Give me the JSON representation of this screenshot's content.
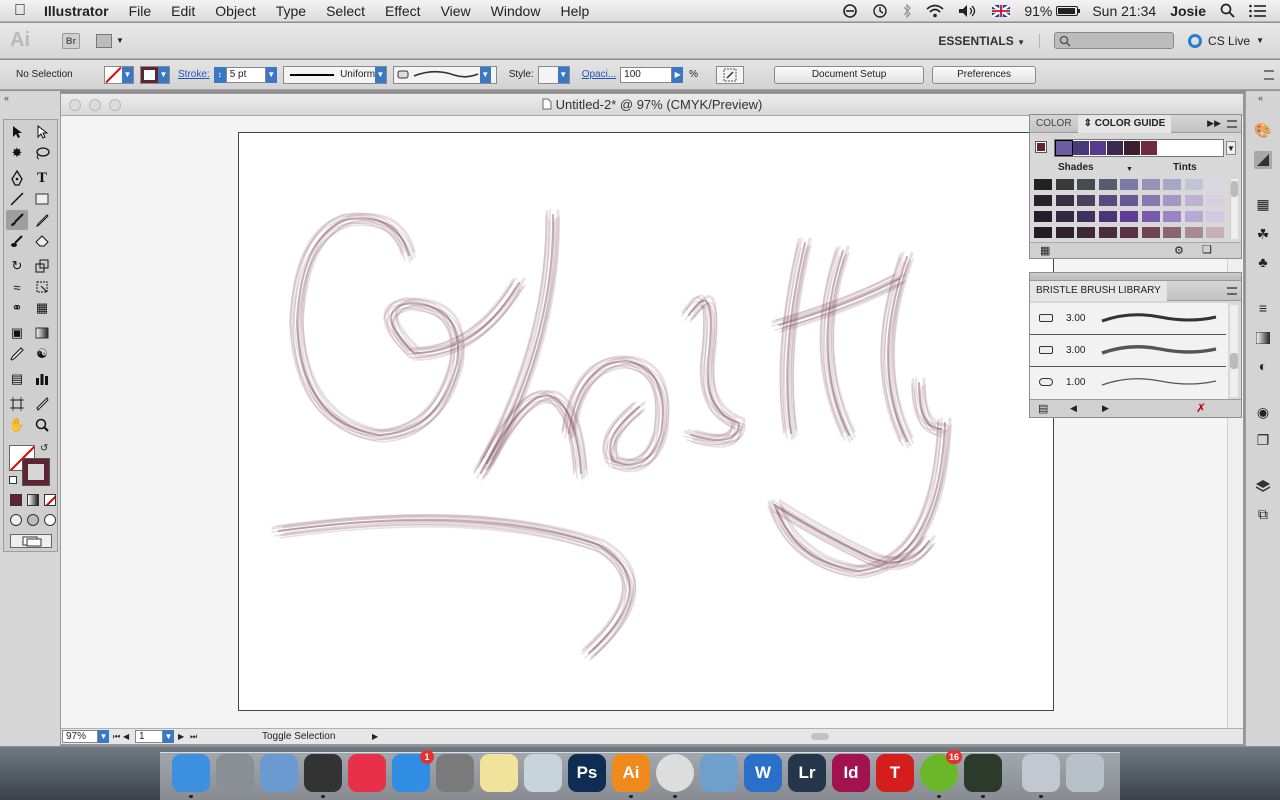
{
  "menubar": {
    "app_name": "Illustrator",
    "items": [
      "File",
      "Edit",
      "Object",
      "Type",
      "Select",
      "Effect",
      "View",
      "Window",
      "Help"
    ],
    "battery": "91%",
    "battery_level": 0.91,
    "clock": "Sun 21:34",
    "user": "Josie"
  },
  "appbar": {
    "ai_logo": "Ai",
    "bridge_label": "Br",
    "workspace": "ESSENTIALS",
    "search_placeholder": "",
    "cs_live": "CS Live"
  },
  "control": {
    "selection": "No Selection",
    "stroke_label": "Stroke:",
    "stroke_weight": "5 pt",
    "profile": "Uniform",
    "style_label": "Style:",
    "opacity_label": "Opaci...",
    "opacity_value": "100",
    "percent": "%",
    "document_setup": "Document Setup",
    "preferences": "Preferences",
    "stroke_color": "#5e2431"
  },
  "document": {
    "title": "Untitled-2* @ 97% (CMYK/Preview)",
    "zoom": "97%",
    "page": "1",
    "status": "Toggle Selection",
    "brush_color": "#6f3a4a"
  },
  "color_panel": {
    "tab_color": "COLOR",
    "tab_guide": "COLOR GUIDE",
    "harmony_colors": [
      "#6c5fa0",
      "#463a78",
      "#5a3a8c",
      "#3a2a52",
      "#3c1d2e",
      "#6e2a3e"
    ],
    "shades_label": "Shades",
    "tints_label": "Tints",
    "grid_rows": [
      [
        "#222222",
        "#3a3a3a",
        "#4a4a52",
        "#5c5a70",
        "#7d78a4",
        "#9892b6",
        "#aaa6c6",
        "#c4c2d6",
        "#d8d7e2"
      ],
      [
        "#262228",
        "#363040",
        "#4a4060",
        "#5a4a80",
        "#6a5896",
        "#8878b0",
        "#a496c4",
        "#bcb2d4",
        "#d6d0e2"
      ],
      [
        "#241e2a",
        "#322840",
        "#403060",
        "#4c3478",
        "#5e3c96",
        "#7a5ab0",
        "#9c84c4",
        "#b8a8d4",
        "#d2c8e2"
      ],
      [
        "#241c22",
        "#30222a",
        "#3e2a36",
        "#4a2c3c",
        "#5a3242",
        "#6e4452",
        "#8a6470",
        "#a88a94",
        "#c8b0b8"
      ]
    ]
  },
  "brush_panel": {
    "title": "BRISTLE BRUSH LIBRARY",
    "brushes": [
      {
        "size": "3.00",
        "kind": "flat-brush-icon"
      },
      {
        "size": "3.00",
        "kind": "flat-brush-icon"
      },
      {
        "size": "1.00",
        "kind": "round-brush-icon"
      }
    ]
  },
  "dock": {
    "apps": [
      {
        "name": "Finder",
        "label": "",
        "color": "#3d8fe0",
        "badge": ""
      },
      {
        "name": "Launchpad",
        "label": "",
        "color": "#8a8f96",
        "badge": ""
      },
      {
        "name": "Preview",
        "label": "",
        "color": "#6a9ad0",
        "badge": ""
      },
      {
        "name": "Dashboard",
        "label": "",
        "color": "#333333",
        "badge": ""
      },
      {
        "name": "iTunes",
        "label": "",
        "color": "#e8304a",
        "badge": ""
      },
      {
        "name": "App Store",
        "label": "",
        "color": "#2f8de4",
        "badge": "1"
      },
      {
        "name": "System Preferences",
        "label": "",
        "color": "#7a7a7a",
        "badge": ""
      },
      {
        "name": "Notes",
        "label": "",
        "color": "#f1e49a",
        "badge": ""
      },
      {
        "name": "Photo Booth",
        "label": "",
        "color": "#c8d4dc",
        "badge": ""
      },
      {
        "name": "Photoshop",
        "label": "Ps",
        "color": "#0f2d52",
        "badge": ""
      },
      {
        "name": "Illustrator",
        "label": "Ai",
        "color": "#f08a1c",
        "badge": ""
      },
      {
        "name": "Chrome",
        "label": "",
        "color": "#dddddd",
        "badge": ""
      },
      {
        "name": "Mail",
        "label": "",
        "color": "#6fa0cc",
        "badge": ""
      },
      {
        "name": "Word",
        "label": "W",
        "color": "#2a70c8",
        "badge": ""
      },
      {
        "name": "Lightroom",
        "label": "Lr",
        "color": "#23364a",
        "badge": ""
      },
      {
        "name": "InDesign",
        "label": "Id",
        "color": "#a2124e",
        "badge": ""
      },
      {
        "name": "Typeface",
        "label": "T",
        "color": "#d41e1e",
        "badge": ""
      },
      {
        "name": "Spotify",
        "label": "",
        "color": "#6ab82a",
        "badge": "16"
      },
      {
        "name": "Camera",
        "label": "",
        "color": "#2c3a2c",
        "badge": ""
      },
      {
        "name": "Documents",
        "label": "",
        "color": "#c2c8d0",
        "badge": ""
      },
      {
        "name": "Trash",
        "label": "",
        "color": "#b8c0c8",
        "badge": ""
      }
    ]
  }
}
